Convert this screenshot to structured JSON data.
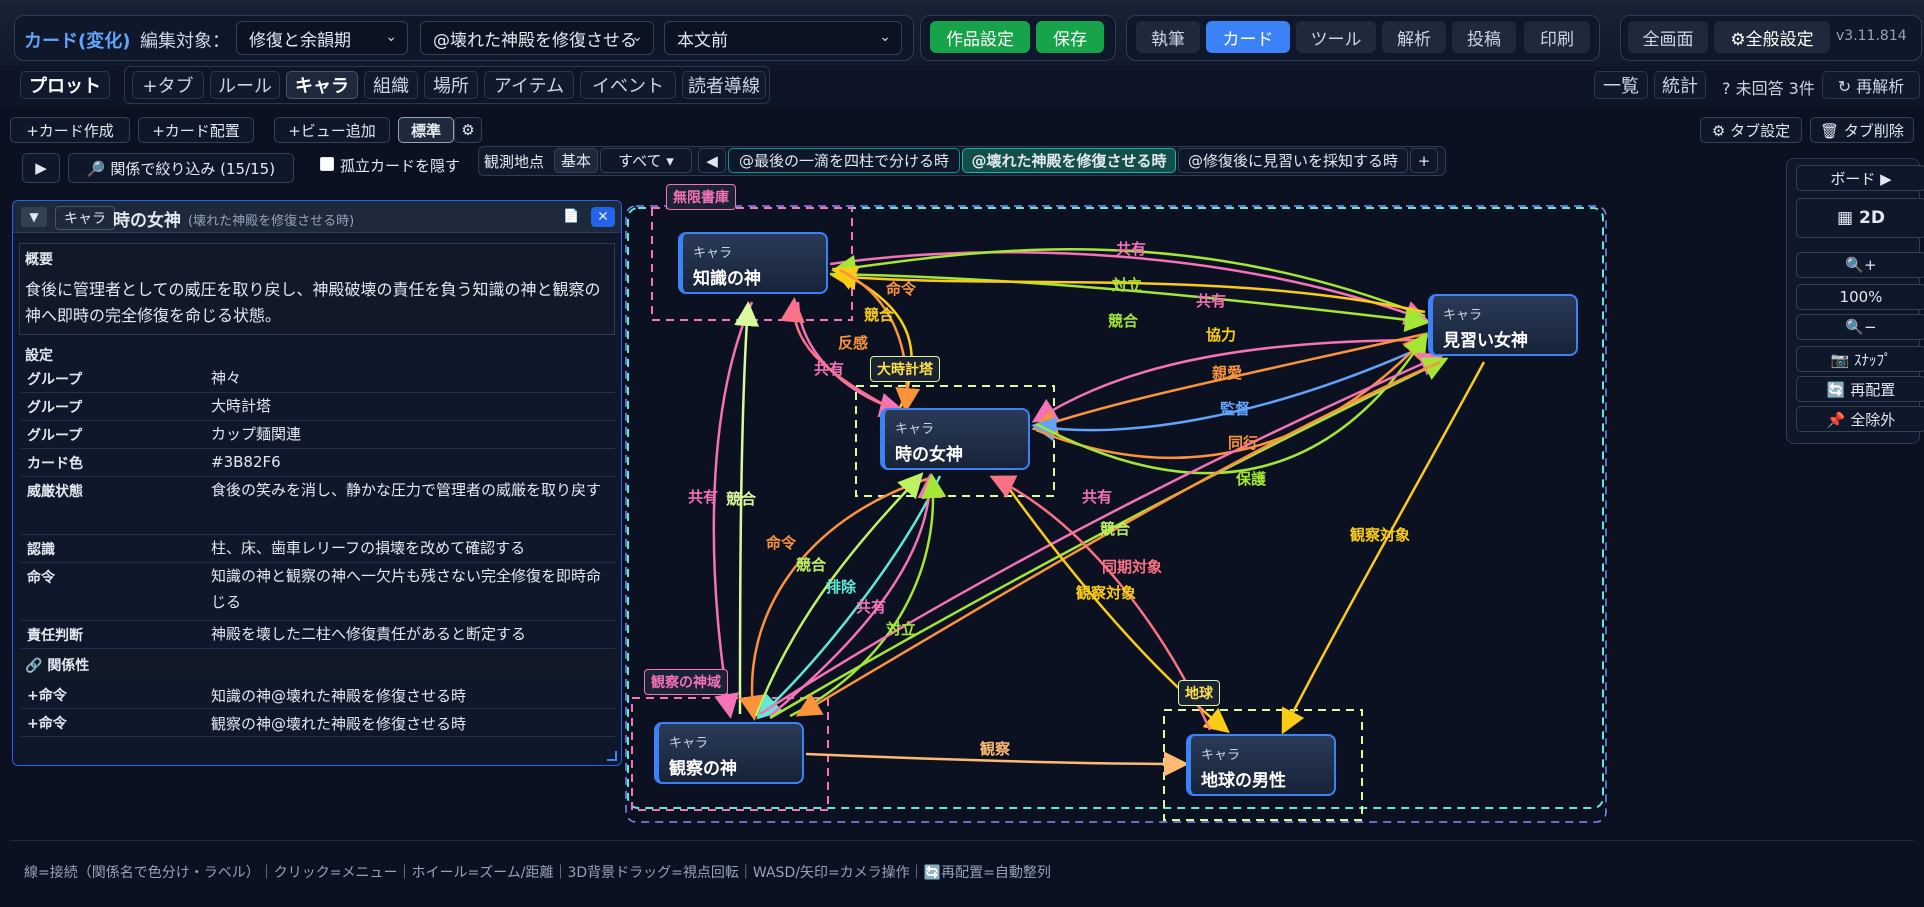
{
  "header": {
    "mode": "カード(変化)",
    "edit_target_label": "編集対象：",
    "select1": "修復と余韻期",
    "select2": "@壊れた神殿を修復させる",
    "select3": "本文前",
    "work_settings": "作品設定",
    "save": "保存",
    "nav": [
      "執筆",
      "カード",
      "ツール",
      "解析",
      "投稿",
      "印刷"
    ],
    "fullscreen": "全画面",
    "general_settings": "⚙全般設定",
    "version": "v3.11.814"
  },
  "tabs": {
    "plot": "プロット",
    "add_tab": "+タブ",
    "items": [
      "ルール",
      "キャラ",
      "組織",
      "場所",
      "アイテム",
      "イベント",
      "読者導線"
    ],
    "list": "一覧",
    "stats": "統計",
    "unanswered": "? 未回答 3件",
    "reanalyze": "↻ 再解析"
  },
  "toolbar": {
    "create_card": "+カード作成",
    "place_card": "+カード配置",
    "add_view": "+ビュー追加",
    "standard": "標準",
    "tab_settings": "⚙ タブ設定",
    "tab_delete": "🗑 タブ削除",
    "filter": "🔎 関係で絞り込み (15/15)",
    "hide_isolated": "孤立カードを隠す",
    "observe_point": "観測地点",
    "basic": "基本",
    "all": "すべて ▾",
    "timeline": [
      "@最後の一滴を四柱で分ける時",
      "@壊れた神殿を修復させる時",
      "@修復後に見習いを採知する時"
    ]
  },
  "card": {
    "type": "キャラ",
    "name": "時の女神",
    "context": "(壊れた神殿を修復させる時)",
    "summary_label": "概要",
    "summary": "食後に管理者としての威圧を取り戻し、神殿破壊の責任を負う知識の神と観察の神へ即時の完全修復を命じる状態。",
    "settings_label": "設定",
    "rows": [
      [
        "グループ",
        "神々"
      ],
      [
        "グループ",
        "大時計塔"
      ],
      [
        "グループ",
        "カップ麺関連"
      ],
      [
        "カード色",
        "#3B82F6"
      ],
      [
        "威厳状態",
        "食後の笑みを消し、静かな圧力で管理者の威厳を取り戻す"
      ],
      [
        "認識",
        "柱、床、歯車レリーフの損壊を改めて確認する"
      ],
      [
        "命令",
        "知識の神と観察の神へ一欠片も残さない完全修復を即時命じる"
      ],
      [
        "責任判断",
        "神殿を壊した二柱へ修復責任があると断定する"
      ]
    ],
    "relations_label": "関係性",
    "relations": [
      [
        "+命令",
        "知識の神@壊れた神殿を修復させる時"
      ],
      [
        "+命令",
        "観察の神@壊れた神殿を修復させる時"
      ]
    ]
  },
  "graph": {
    "node_type": "キャラ",
    "nodes": [
      "知識の神",
      "時の女神",
      "見習い女神",
      "観察の神",
      "地球の男性"
    ],
    "groups": [
      "無限書庫",
      "大時計塔",
      "観察の神域",
      "地球"
    ],
    "edge_labels": [
      "共有",
      "対立",
      "共有",
      "競合",
      "協力",
      "命令",
      "競合",
      "反感",
      "共有",
      "親愛",
      "監督",
      "同行",
      "保護",
      "共有",
      "競合",
      "命令",
      "競合",
      "排除",
      "共有",
      "対立",
      "共有",
      "競合",
      "同期対象",
      "観察対象",
      "観察対象",
      "観察"
    ]
  },
  "right": {
    "board": "ボード ▶",
    "mode2d": "▦ 2D",
    "zoom_in": "🔍+",
    "zoom": "100%",
    "zoom_out": "🔍−",
    "snap": "📷 ｽﾅｯﾌﾟ",
    "relayout": "🔄 再配置",
    "clear": "📌 全除外"
  },
  "footer": "線=接続（関係名で色分け・ラベル）｜クリック=メニュー｜ホイール=ズーム/距離｜3D背景ドラッグ=視点回転｜WASD/矢印=カメラ操作｜🔄再配置=自動整列",
  "colors": {
    "accent": "#3b82f6",
    "green": "#16a34a"
  }
}
